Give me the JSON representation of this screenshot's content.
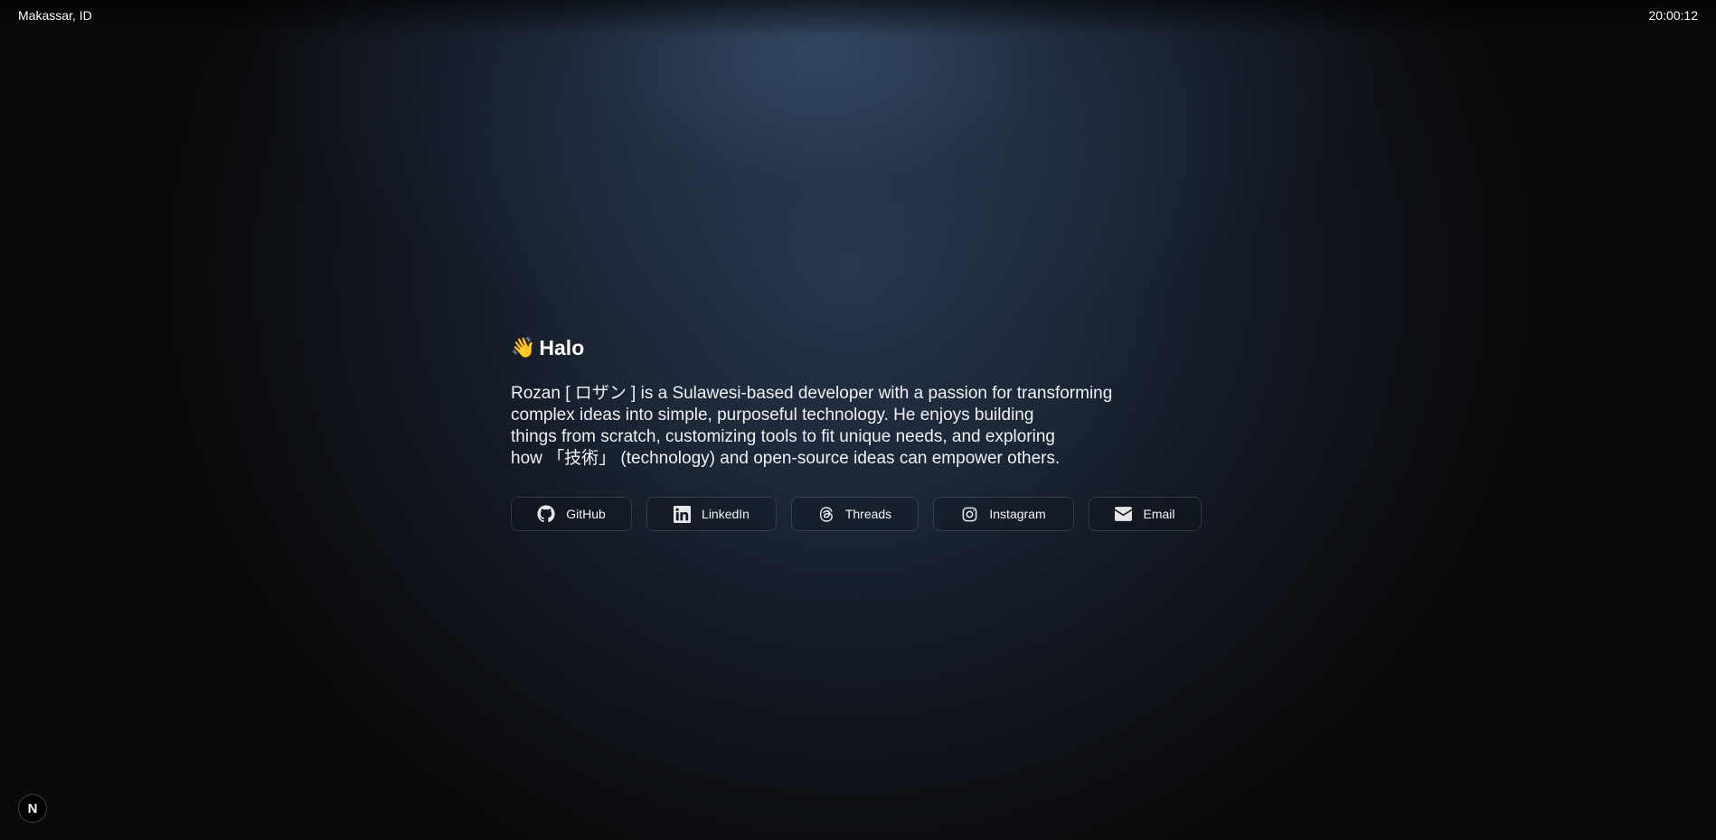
{
  "header": {
    "location": "Makassar, ID",
    "time": "20:00:12"
  },
  "hero": {
    "wave_emoji": "👋",
    "greeting": "Halo",
    "bio_lines": [
      "Rozan [ ロザン ] is a Sulawesi-based developer with a passion for transforming",
      "complex ideas into simple, purposeful technology. He enjoys building",
      "things from scratch, customizing tools to fit unique needs, and exploring",
      "how 「技術」 (technology) and open-source ideas can empower others."
    ]
  },
  "links": [
    {
      "label": "GitHub",
      "icon": "github-icon"
    },
    {
      "label": "LinkedIn",
      "icon": "linkedin-icon"
    },
    {
      "label": "Threads",
      "icon": "threads-icon"
    },
    {
      "label": "Instagram",
      "icon": "instagram-icon"
    },
    {
      "label": "Email",
      "icon": "mail-icon"
    }
  ],
  "badge": {
    "letter": "N",
    "icon": "nextjs-icon"
  },
  "colors": {
    "background": "#0a0a0a",
    "glow": "#26364c",
    "text": "#f4f4f5"
  }
}
